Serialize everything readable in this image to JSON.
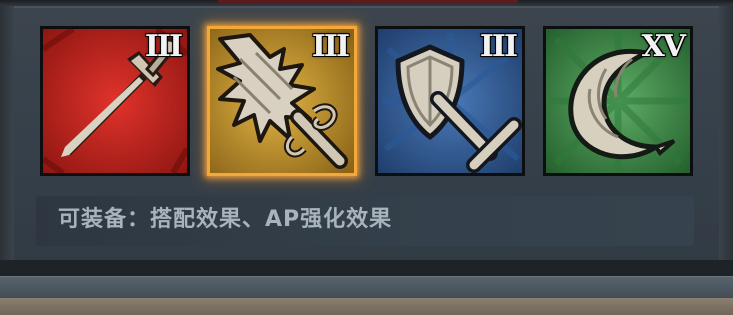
{
  "skills": [
    {
      "name": "sword-skill",
      "rank": "III",
      "selected": false
    },
    {
      "name": "flame-blade-skill",
      "rank": "III",
      "selected": true
    },
    {
      "name": "shield-sword-skill",
      "rank": "III",
      "selected": false
    },
    {
      "name": "crescent-moon-skill",
      "rank": "XV",
      "selected": false
    }
  ],
  "info": {
    "text": "可装备：搭配效果、AP强化效果"
  },
  "colors": {
    "sword_bg": "#c8231e",
    "flame_bg": "#c9952a",
    "shield_bg": "#2f5a94",
    "moon_bg": "#3f8a4a",
    "selected_border": "#f2a93a",
    "info_text": "#a9b3bd"
  }
}
